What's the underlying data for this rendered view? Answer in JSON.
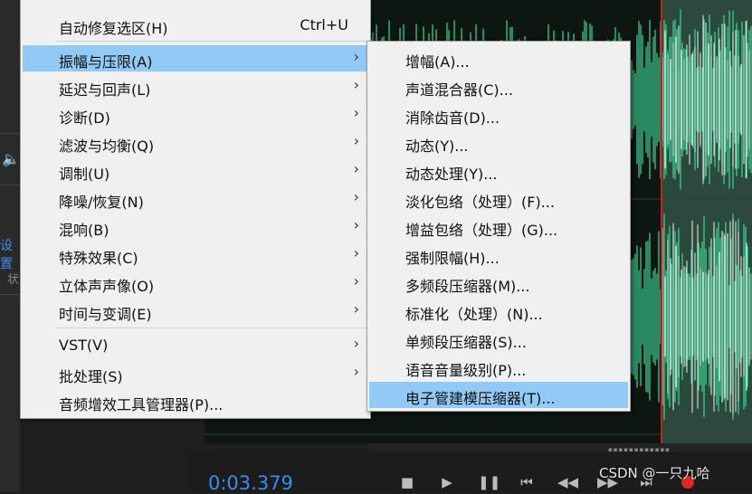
{
  "main_menu": {
    "items": [
      {
        "label": "自动修复选区(H)",
        "shortcut": "Ctrl+U"
      },
      {
        "label": "振幅与压限(A)"
      },
      {
        "label": "延迟与回声(L)"
      },
      {
        "label": "诊断(D)"
      },
      {
        "label": "滤波与均衡(Q)"
      },
      {
        "label": "调制(U)"
      },
      {
        "label": "降噪/恢复(N)"
      },
      {
        "label": "混响(B)"
      },
      {
        "label": "特殊效果(C)"
      },
      {
        "label": "立体声声像(O)"
      },
      {
        "label": "时间与变调(E)"
      },
      {
        "label": "VST(V)"
      },
      {
        "label": "批处理(S)"
      },
      {
        "label": "音频增效工具管理器(P)..."
      }
    ],
    "highlighted": "振幅与压限(A)"
  },
  "sub_menu": {
    "items": [
      {
        "label": "增幅(A)..."
      },
      {
        "label": "声道混合器(C)..."
      },
      {
        "label": "消除齿音(D)..."
      },
      {
        "label": "动态(Y)..."
      },
      {
        "label": "动态处理(Y)..."
      },
      {
        "label": "淡化包络（处理）(F)..."
      },
      {
        "label": "增益包络（处理）(G)..."
      },
      {
        "label": "强制限幅(H)..."
      },
      {
        "label": "多频段压缩器(M)..."
      },
      {
        "label": "标准化（处理）(N)..."
      },
      {
        "label": "单频段压缩器(S)..."
      },
      {
        "label": "语音音量级别(P)..."
      },
      {
        "label": "电子管建模压缩器(T)..."
      }
    ],
    "highlighted": "电子管建模压缩器(T)..."
  },
  "left_panel": {
    "settings_fragment": "设置",
    "fragment2": "状"
  },
  "transport": {
    "timecode": "0:03.379"
  },
  "watermark": "CSDN @一只九哈",
  "icons": {
    "speaker": "speaker-icon",
    "submenu_arrow": "chevron-right-icon",
    "stop": "stop-icon",
    "play": "play-icon",
    "pause": "pause-icon",
    "to_start": "skip-to-start-icon",
    "rewind": "rewind-icon",
    "forward": "fast-forward-icon",
    "to_end": "skip-to-end-icon",
    "record": "record-icon"
  },
  "colors": {
    "highlight": "#91c9f7",
    "waveform": "#3fd698",
    "playhead": "#c8202b",
    "timecode": "#3d8bf0",
    "menu_bg": "#f0f0f0"
  }
}
